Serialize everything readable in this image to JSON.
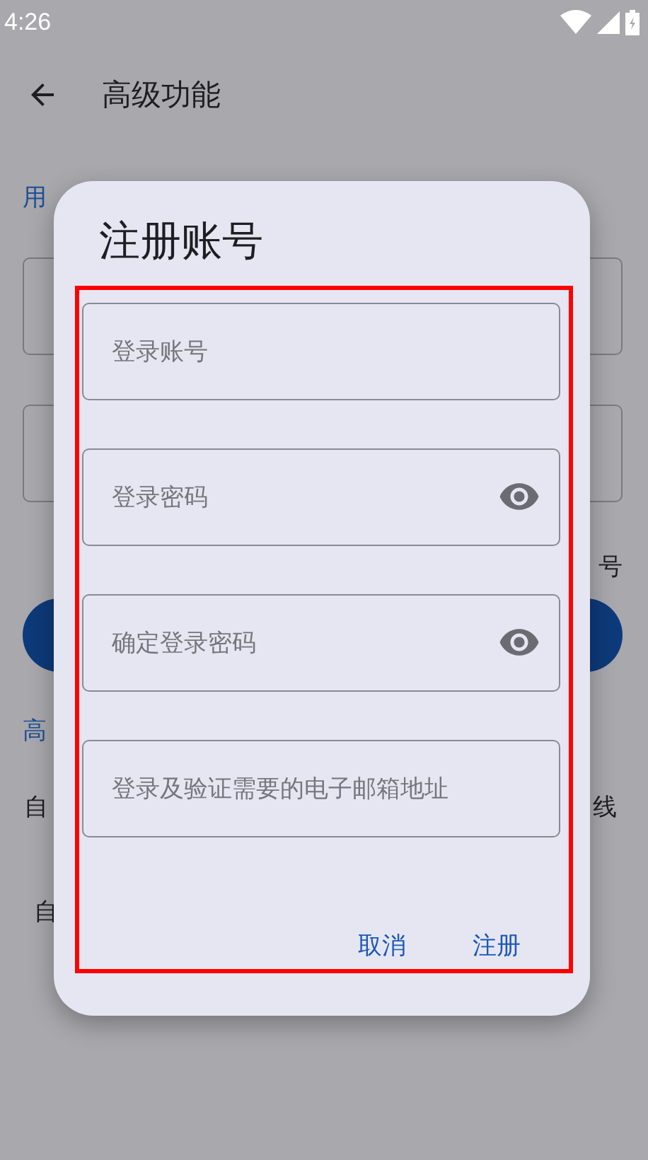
{
  "status_bar": {
    "time": "4:26"
  },
  "app_bar": {
    "title": "高级功能"
  },
  "background": {
    "section_label": "用",
    "fields": [
      {
        "kind": "field"
      },
      {
        "kind": "field"
      }
    ],
    "side_text": "号",
    "section_label_2": "高",
    "row_1": {
      "left": "自",
      "right": "线"
    },
    "row_2": {
      "left": "自"
    }
  },
  "dialog": {
    "title": "注册账号",
    "fields": [
      {
        "placeholder": "登录账号",
        "password": false
      },
      {
        "placeholder": "登录密码",
        "password": true
      },
      {
        "placeholder": "确定登录密码",
        "password": true
      },
      {
        "placeholder": "登录及验证需要的电子邮箱地址",
        "password": false
      }
    ],
    "buttons": [
      "取消",
      "注册"
    ]
  }
}
